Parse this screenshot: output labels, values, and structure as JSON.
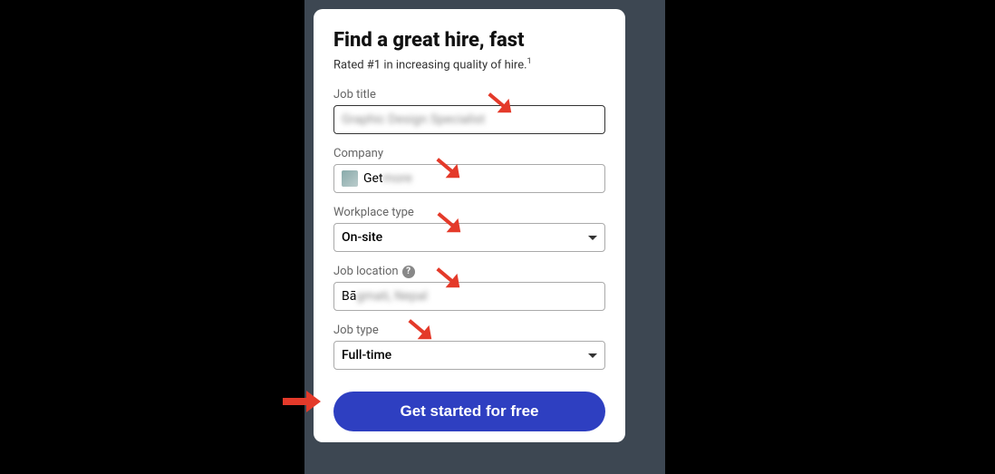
{
  "modal": {
    "title": "Find a great hire, fast",
    "subtitle_prefix": "Rated #1 in increasing quality of hire.",
    "subtitle_sup": "1"
  },
  "fields": {
    "job_title": {
      "label": "Job title",
      "value": "Graphic Design Specialist"
    },
    "company": {
      "label": "Company",
      "value_prefix": "Get",
      "value_blur": "more"
    },
    "workplace": {
      "label": "Workplace type",
      "value": "On-site"
    },
    "location": {
      "label": "Job location",
      "value_prefix": "Bā",
      "value_blur": "gmati, Nepal"
    },
    "job_type": {
      "label": "Job type",
      "value": "Full-time"
    }
  },
  "cta": {
    "label": "Get started for free"
  }
}
